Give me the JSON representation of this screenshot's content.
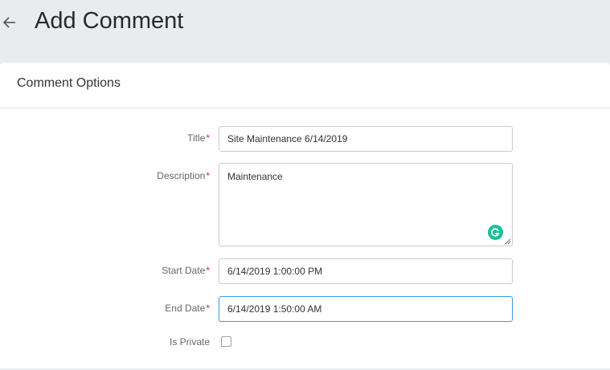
{
  "header": {
    "title": "Add Comment",
    "back_icon": "arrow-left-icon"
  },
  "card": {
    "title": "Comment Options"
  },
  "form": {
    "required_marker": "*",
    "title": {
      "label": "Title",
      "value": "Site Maintenance 6/14/2019"
    },
    "description": {
      "label": "Description",
      "value": "Maintenance",
      "assistant_icon": "grammarly-icon"
    },
    "start_date": {
      "label": "Start Date",
      "value": "6/14/2019 1:00:00 PM"
    },
    "end_date": {
      "label": "End Date",
      "value": "6/14/2019 1:50:00 AM"
    },
    "is_private": {
      "label": "Is Private",
      "checked": false
    }
  },
  "colors": {
    "background": "#e8ecef",
    "required": "#c9302c",
    "focus_border": "#3a9ad9",
    "grammarly": "#15c39a"
  }
}
